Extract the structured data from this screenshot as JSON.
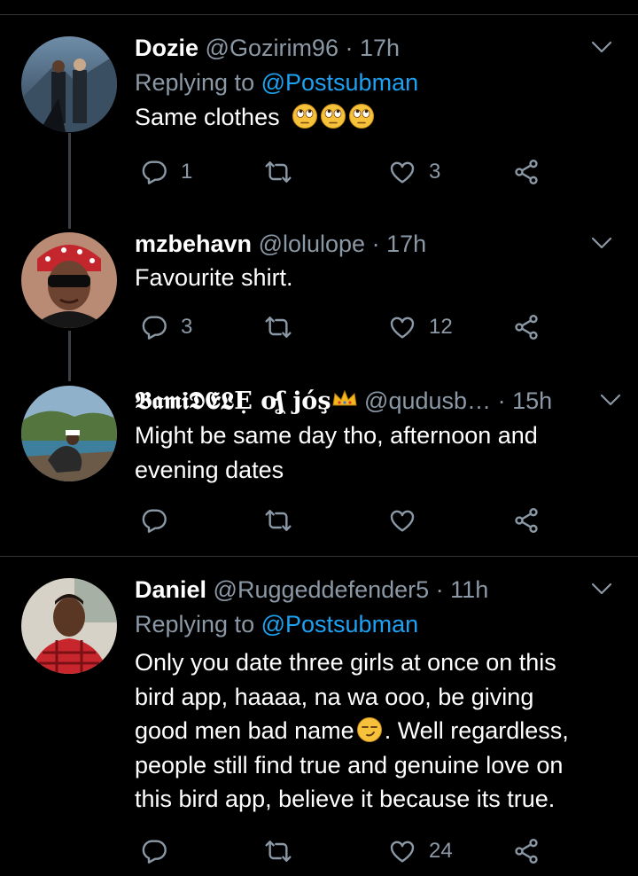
{
  "tweets": [
    {
      "name": "Dozie",
      "handle": "@Gozirim96",
      "sep": "·",
      "time": "17h",
      "replying_prefix": "Replying to",
      "replying_to": "@Postsubman",
      "text": "Same clothes",
      "emoji": "face-with-rolling-eyes x3",
      "reply_count": "1",
      "retweet_count": "",
      "like_count": "3"
    },
    {
      "name": "mzbehavn",
      "handle": "@lolulope",
      "sep": "·",
      "time": "17h",
      "text": "Favourite shirt.",
      "reply_count": "3",
      "retweet_count": "",
      "like_count": "12"
    },
    {
      "name": "𝕭𝖆𝖒𝖎𝕯𝕰𝕷Ẹ ơʆ jóş",
      "name_icon": "crown",
      "handle": "@qudusb…",
      "sep": "·",
      "time": "15h",
      "text_line1": "Might be same day tho, afternoon and",
      "text_line2": "evening dates",
      "reply_count": "",
      "retweet_count": "",
      "like_count": ""
    },
    {
      "name": "Daniel",
      "handle": "@Ruggeddefender5",
      "sep": "·",
      "time": "11h",
      "replying_prefix": "Replying to",
      "replying_to": "@Postsubman",
      "text_line1": "Only you date three girls at once on this",
      "text_line2": "bird app, haaaa, na wa ooo, be giving",
      "text_line3a": "good men bad name",
      "text_line3b": ". Well regardless,",
      "text_line4": "people still find true and genuine love on",
      "text_line5": "this bird app, believe it because its true.",
      "emoji": "smirking-face",
      "reply_count": "",
      "retweet_count": "",
      "like_count": "24"
    }
  ],
  "colors": {
    "background": "#000000",
    "text": "#ffffff",
    "secondary": "#8b98a5",
    "link": "#1da1f2",
    "divider": "#2f3336"
  },
  "icons": [
    "reply-icon",
    "retweet-icon",
    "like-icon",
    "share-icon",
    "caret-down-icon"
  ]
}
